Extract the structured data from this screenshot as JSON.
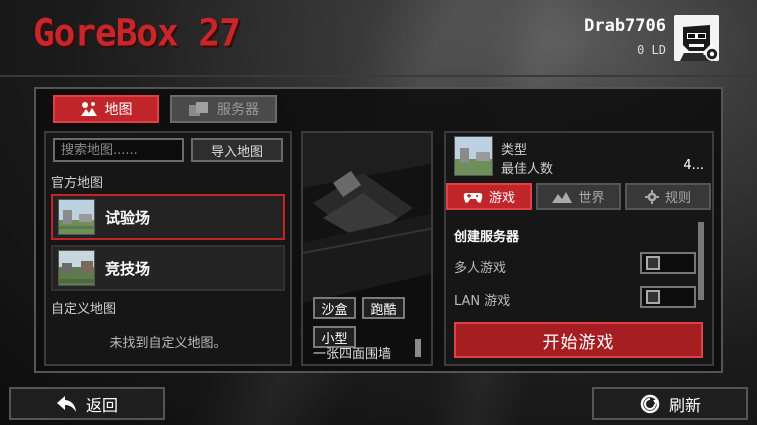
{
  "header": {
    "logo_text": "GoreBox 27",
    "username": "Drab7706",
    "level": "0 LD"
  },
  "tabs": {
    "map_label": "地图",
    "server_label": "服务器"
  },
  "left_panel": {
    "search_placeholder": "搜索地图......",
    "import_label": "导入地图",
    "official_label": "官方地图",
    "maps": [
      {
        "name": "试验场",
        "selected": true
      },
      {
        "name": "竞技场",
        "selected": false
      }
    ],
    "custom_label": "自定义地图",
    "empty_message": "未找到自定义地图。"
  },
  "preview": {
    "tags": [
      "沙盒",
      "跑酷",
      "小型"
    ],
    "description": "一张四面围墙"
  },
  "right_panel": {
    "type_label": "类型",
    "max_players_label": "最佳人数",
    "max_players_value": "4...",
    "tabs": [
      {
        "label": "游戏",
        "icon": "gamepad-icon",
        "active": true
      },
      {
        "label": "世界",
        "icon": "mountain-icon",
        "active": false
      },
      {
        "label": "规则",
        "icon": "gear-icon",
        "active": false
      }
    ],
    "settings_title": "创建服务器",
    "settings": [
      {
        "label": "多人游戏",
        "checked": false
      },
      {
        "label": "LAN 游戏",
        "checked": false
      }
    ],
    "start_label": "开始游戏"
  },
  "footer": {
    "back_label": "返回",
    "refresh_label": "刷新"
  },
  "colors": {
    "accent": "#c0252a",
    "accent_border": "#e04046"
  }
}
